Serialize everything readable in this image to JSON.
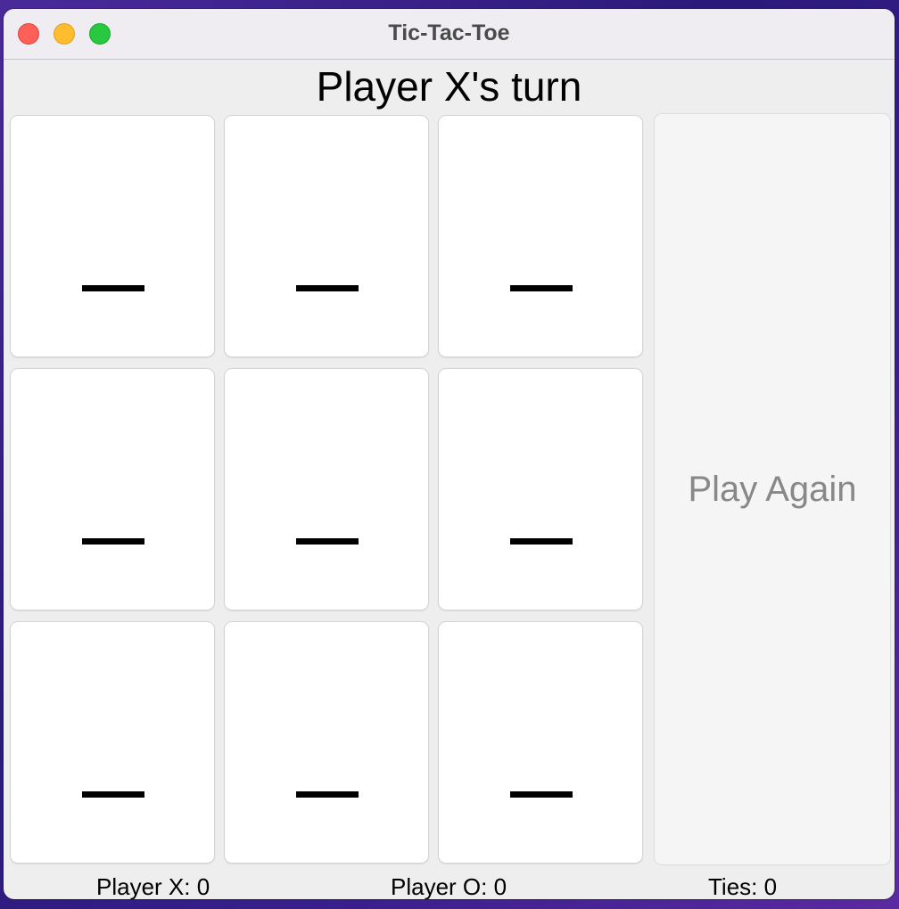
{
  "window": {
    "title": "Tic-Tac-Toe"
  },
  "game": {
    "turn_label": "Player X's turn",
    "board": [
      "—",
      "—",
      "—",
      "—",
      "—",
      "—",
      "—",
      "—",
      "—"
    ],
    "play_again_label": "Play Again"
  },
  "scores": {
    "player_x": "Player X: 0",
    "player_o": "Player O: 0",
    "ties": "Ties: 0"
  },
  "colors": {
    "close": "#fe5f57",
    "minimize": "#febc2e",
    "maximize": "#28c840",
    "play_again_text": "#888888"
  }
}
